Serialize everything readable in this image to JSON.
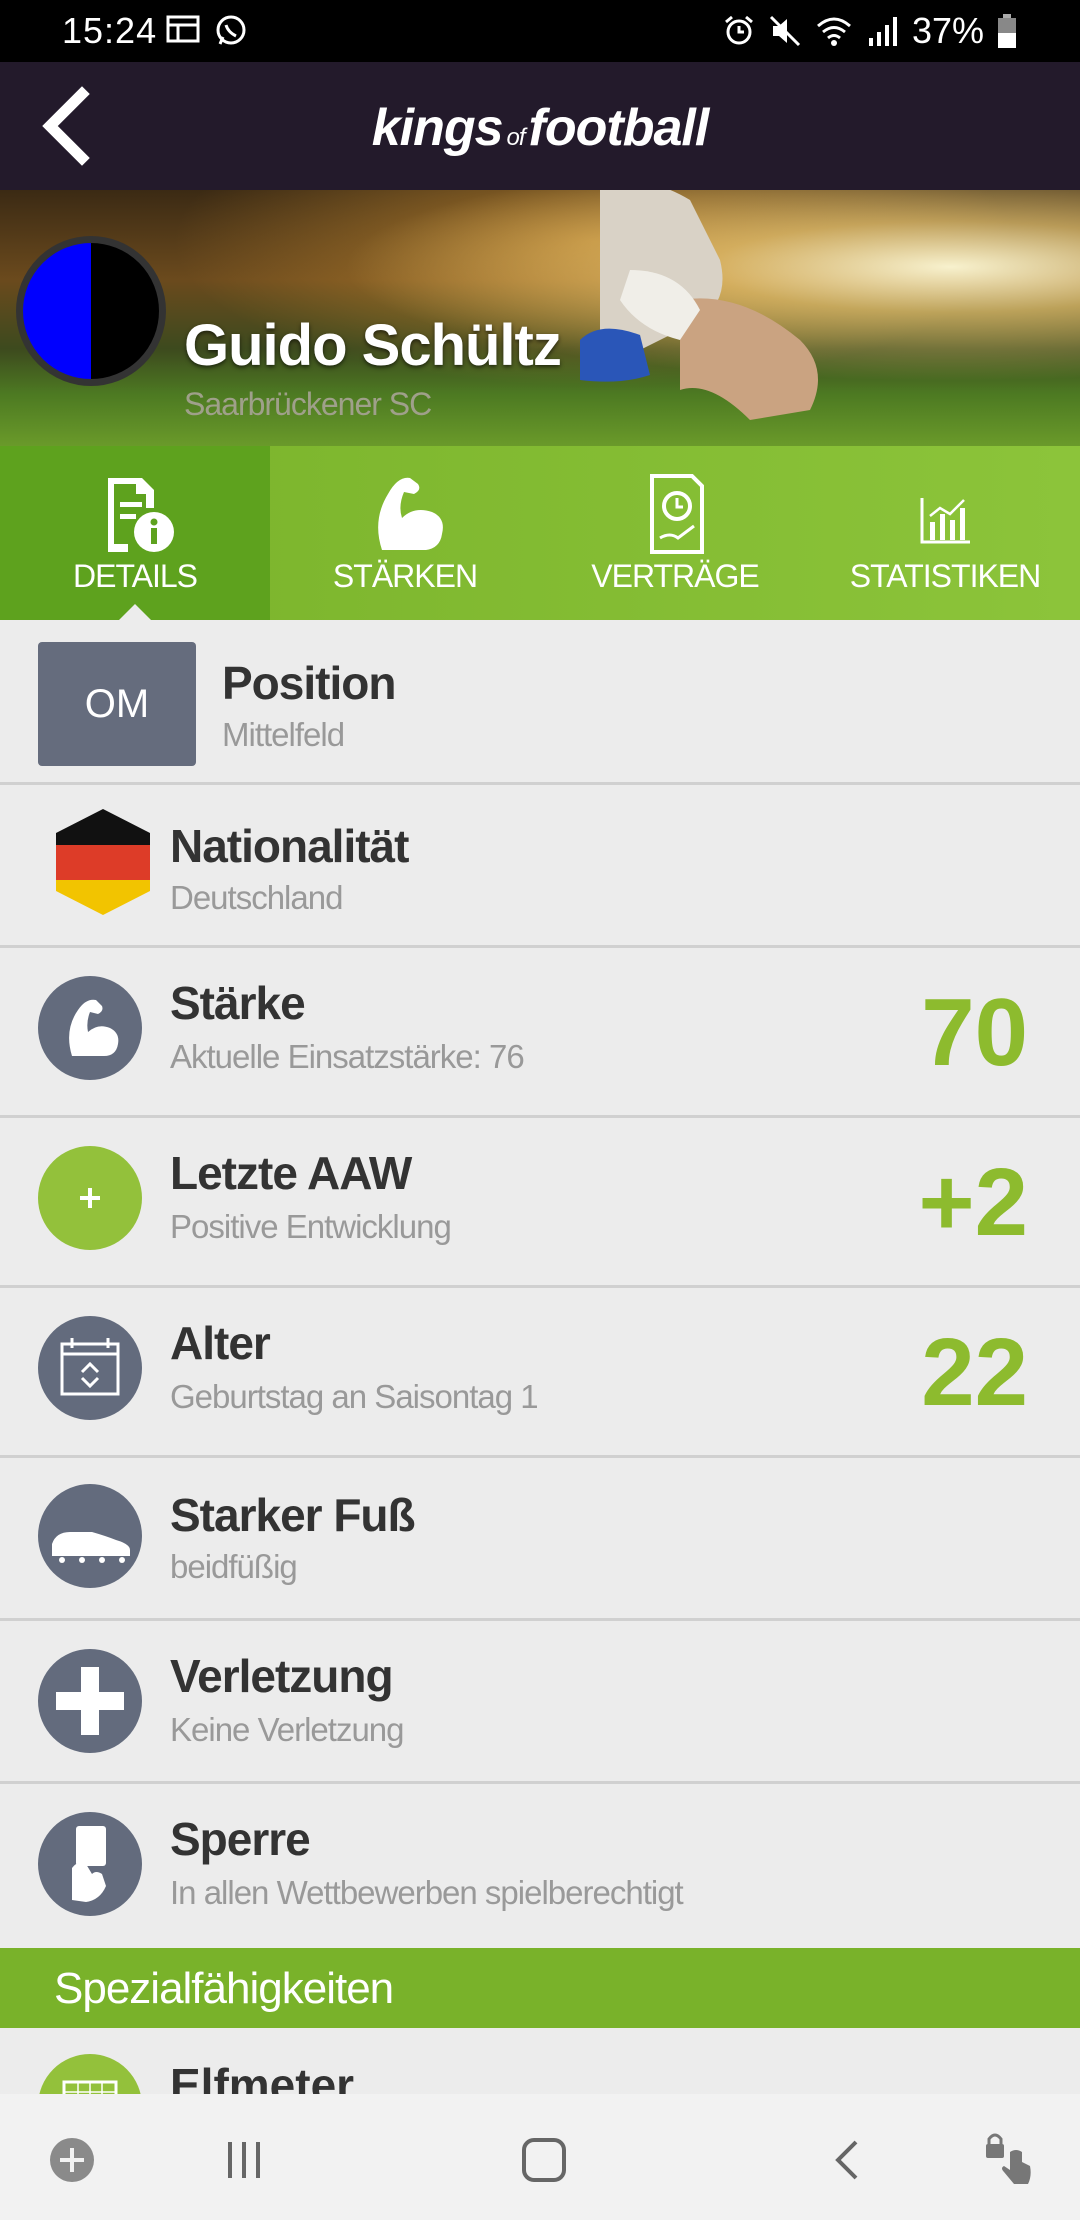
{
  "status_bar": {
    "time": "15:24",
    "battery": "37%",
    "left_icons": [
      "gallery-icon",
      "whatsapp-icon"
    ],
    "right_icons": [
      "alarm-icon",
      "mute-icon",
      "wifi-icon",
      "signal-icon",
      "battery-icon"
    ]
  },
  "app": {
    "brand_left": "kings",
    "brand_of": "of",
    "brand_right": "football"
  },
  "player": {
    "name": "Guido Schültz",
    "club": "Saarbrückener SC",
    "club_colors": [
      "#0000ff",
      "#000000"
    ]
  },
  "tabs": [
    {
      "label": "DETAILS",
      "icon": "document-info-icon",
      "active": true
    },
    {
      "label": "STÄRKEN",
      "icon": "muscle-icon",
      "active": false
    },
    {
      "label": "VERTRÄGE",
      "icon": "contract-icon",
      "active": false
    },
    {
      "label": "STATISTIKEN",
      "icon": "bar-chart-icon",
      "active": false
    }
  ],
  "details": {
    "position": {
      "badge": "OM",
      "title": "Position",
      "sub": "Mittelfeld"
    },
    "nationality": {
      "title": "Nationalität",
      "sub": "Deutschland",
      "flag_colors": [
        "#000000",
        "#dd3c28",
        "#f2c400"
      ]
    },
    "strength": {
      "title": "Stärke",
      "sub": "Aktuelle Einsatzstärke: 76",
      "value": "70",
      "icon": "muscle-icon"
    },
    "last_aaw": {
      "title": "Letzte AAW",
      "sub": "Positive Entwicklung",
      "value": "+2",
      "icon": "plus-icon"
    },
    "age": {
      "title": "Alter",
      "sub": "Geburtstag an Saisontag 1",
      "value": "22",
      "icon": "calendar-icon"
    },
    "foot": {
      "title": "Starker Fuß",
      "sub": "beidfüßig",
      "icon": "football-boot-icon"
    },
    "injury": {
      "title": "Verletzung",
      "sub": "Keine Verletzung",
      "icon": "medical-cross-icon"
    },
    "suspension": {
      "title": "Sperre",
      "sub": "In allen Wettbewerben spielberechtigt",
      "icon": "card-hand-icon"
    }
  },
  "special": {
    "header": "Spezialfähigkeiten",
    "first_item": {
      "title": "Elfmeter",
      "icon": "goal-icon"
    }
  },
  "colors": {
    "accent_green": "#8dbb2e",
    "tab_green": "#79b22a",
    "header_dark": "#231a2b",
    "icon_grey": "#636b7d"
  },
  "nav_bar": [
    "game-launcher-icon",
    "recent-apps-icon",
    "home-icon",
    "back-icon",
    "touch-lock-icon"
  ]
}
